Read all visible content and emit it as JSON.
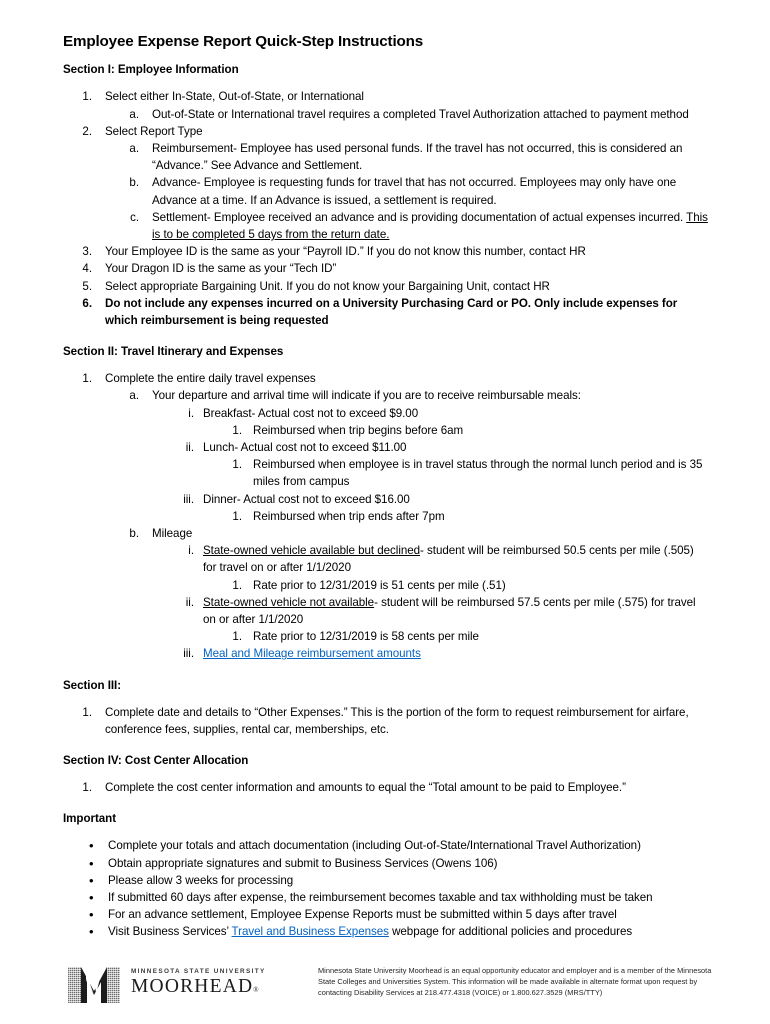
{
  "document": {
    "title": "Employee Expense Report Quick-Step Instructions"
  },
  "section1": {
    "heading": "Section I: Employee Information",
    "items": [
      {
        "marker": "1.",
        "text": "Select either In-State, Out-of-State, or International"
      },
      {
        "marker": "a.",
        "text": "Out-of-State or International travel requires a completed Travel Authorization attached to payment method"
      },
      {
        "marker": "2.",
        "text": "Select Report Type"
      },
      {
        "marker": "a.",
        "text": "Reimbursement- Employee has used personal funds. If the travel has not occurred, this is considered an “Advance.” See Advance and Settlement."
      },
      {
        "marker": "b.",
        "text": "Advance- Employee is requesting funds for travel that has not occurred. Employees may only have one Advance at a time.  If an Advance is issued, a settlement is required."
      },
      {
        "marker": "c.",
        "text_lead": "Settlement- Employee received an advance and is providing documentation of actual expenses incurred. ",
        "text_underlined": "This is to be completed 5 days from the return date."
      },
      {
        "marker": "3.",
        "text": "Your Employee ID is the same as your “Payroll ID.”  If you do not know this number, contact HR"
      },
      {
        "marker": "4.",
        "text": "Your Dragon ID is the same as your “Tech ID”"
      },
      {
        "marker": "5.",
        "text": "Select appropriate Bargaining Unit.  If you do not know your Bargaining Unit, contact HR"
      },
      {
        "marker": "6.",
        "text": "Do not include any expenses incurred on a University Purchasing Card or PO.  Only include expenses for which reimbursement is being requested"
      }
    ]
  },
  "section2": {
    "heading": "Section II: Travel Itinerary and Expenses",
    "items": [
      {
        "marker": "1.",
        "text": "Complete the entire daily travel expenses"
      },
      {
        "marker": "a.",
        "text": "Your departure and arrival time will indicate if you are to receive reimbursable meals:"
      },
      {
        "marker": "i.",
        "text": "Breakfast- Actual cost not to exceed $9.00"
      },
      {
        "marker": "1.",
        "text": "Reimbursed when trip begins before 6am"
      },
      {
        "marker": "ii.",
        "text": "Lunch- Actual cost not to exceed $11.00"
      },
      {
        "marker": "1.",
        "text": "Reimbursed when employee is in travel status through the normal lunch period and is 35 miles from campus"
      },
      {
        "marker": "iii.",
        "text": "Dinner- Actual cost not to exceed $16.00"
      },
      {
        "marker": "1.",
        "text": "Reimbursed when trip ends after 7pm"
      },
      {
        "marker": "b.",
        "text": "Mileage"
      },
      {
        "marker": "i.",
        "text_underlined": "State-owned vehicle available but declined",
        "text_rest": "- student will be reimbursed 50.5 cents per mile (.505) for travel on or after 1/1/2020"
      },
      {
        "marker": "1.",
        "text": "Rate prior to 12/31/2019 is 51 cents per mile (.51)"
      },
      {
        "marker": "ii.",
        "text_underlined": "State-owned vehicle not available",
        "text_rest": "- student will be reimbursed 57.5 cents per mile (.575) for travel on or after 1/1/2020"
      },
      {
        "marker": "1.",
        "text": "Rate prior to 12/31/2019 is 58 cents per mile"
      },
      {
        "marker": "iii.",
        "link_text": "Meal and Mileage reimbursement amounts"
      }
    ]
  },
  "section3": {
    "heading": "Section III:",
    "items": [
      {
        "marker": "1.",
        "text": "Complete date and details to “Other Expenses.”  This is the portion of the form to request reimbursement for airfare, conference fees, supplies, rental car, memberships, etc."
      }
    ]
  },
  "section4": {
    "heading": "Section IV: Cost Center Allocation",
    "items": [
      {
        "marker": "1.",
        "text": "Complete the cost center information and amounts to equal the “Total amount to be paid to Employee.”"
      }
    ]
  },
  "important": {
    "heading": "Important",
    "bullet": "•",
    "items": [
      {
        "text": "Complete your totals and attach documentation (including Out-of-State/International Travel Authorization)"
      },
      {
        "text": "Obtain appropriate signatures and submit to Business Services (Owens 106)"
      },
      {
        "text": "Please allow 3 weeks for processing"
      },
      {
        "text": "If submitted 60 days after expense, the reimbursement becomes taxable and tax withholding must be taken"
      },
      {
        "text": "For an advance settlement, Employee Expense Reports must be submitted within 5 days after travel"
      },
      {
        "text_lead": "Visit Business Services’ ",
        "link_text": "Travel and Business Expenses",
        "text_rest": " webpage for additional policies and procedures"
      }
    ]
  },
  "footer": {
    "logo_line1": "MINNESOTA STATE UNIVERSITY",
    "logo_line2": "MOORHEAD",
    "logo_registered": "®",
    "disclaimer": "Minnesota State University Moorhead is an equal opportunity educator and employer and is a member of the Minnesota State Colleges and Universities System. This information will be made available in alternate format upon request by contacting Disability Services at 218.477.4318 (VOICE) or 1.800.627.3529 (MRS/TTY)"
  },
  "colors": {
    "link": "#0563C1",
    "text": "#000000"
  }
}
